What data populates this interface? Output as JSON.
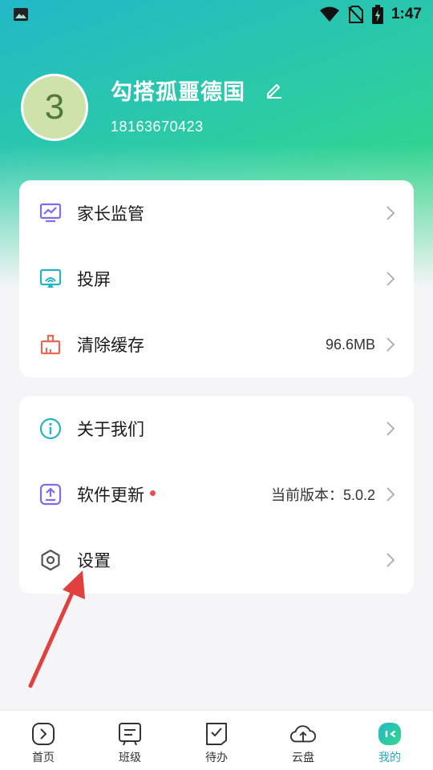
{
  "status_bar": {
    "time": "1:47"
  },
  "profile": {
    "avatar_text": "3",
    "name": "勾搭孤噩德国",
    "phone": "18163670423"
  },
  "card1": {
    "items": [
      {
        "label": "家长监管",
        "icon": "monitor-chart-icon",
        "value": ""
      },
      {
        "label": "投屏",
        "icon": "screen-cast-icon",
        "value": ""
      },
      {
        "label": "清除缓存",
        "icon": "clean-brush-icon",
        "value": "96.6MB"
      }
    ]
  },
  "card2": {
    "items": [
      {
        "label": "关于我们",
        "icon": "info-icon",
        "value": ""
      },
      {
        "label": "软件更新",
        "icon": "upload-update-icon",
        "value": "当前版本：5.0.2",
        "badge": true
      },
      {
        "label": "设置",
        "icon": "hexagon-settings-icon",
        "value": ""
      }
    ]
  },
  "bottom_nav": {
    "items": [
      {
        "label": "首页",
        "icon": "home-play-icon",
        "active": false
      },
      {
        "label": "班级",
        "icon": "class-board-icon",
        "active": false
      },
      {
        "label": "待办",
        "icon": "todo-check-icon",
        "active": false
      },
      {
        "label": "云盘",
        "icon": "cloud-upload-icon",
        "active": false
      },
      {
        "label": "我的",
        "icon": "mine-face-icon",
        "active": true
      }
    ]
  },
  "colors": {
    "gradient_start": "#22b8c8",
    "gradient_end": "#34d58a",
    "accent_active": "#2aa7c9",
    "badge_red": "#f14a52",
    "annotation_arrow": "#e0403f"
  }
}
